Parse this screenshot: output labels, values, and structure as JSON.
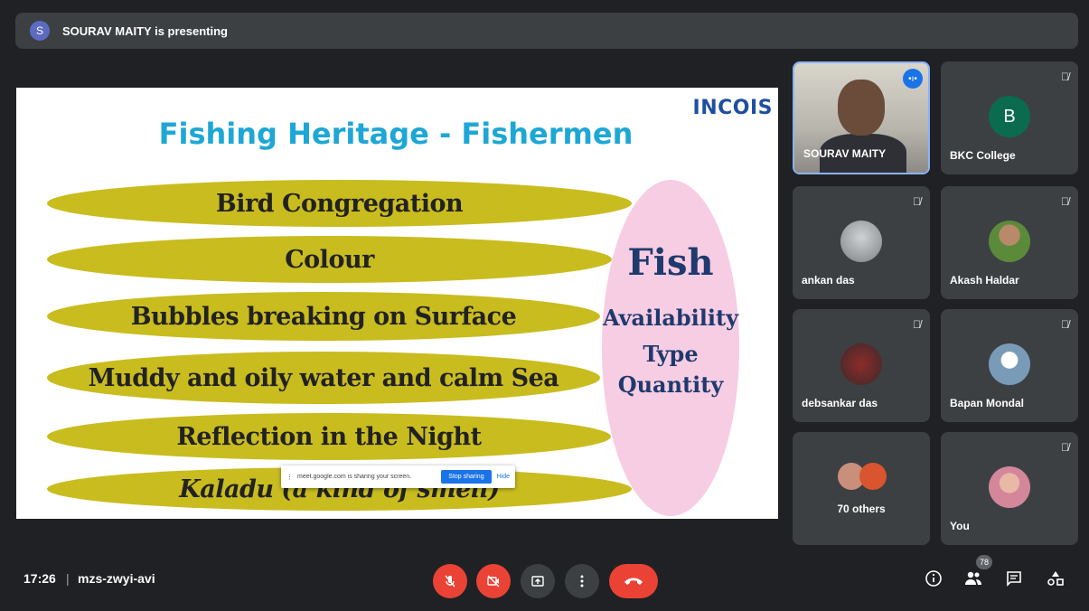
{
  "presenter_bar": {
    "avatar_letter": "S",
    "text": "SOURAV MAITY is presenting"
  },
  "slide": {
    "title": "Fishing Heritage - Fishermen",
    "logo_text": "INCOIS",
    "ellipses": [
      "Bird Congregation",
      "Colour",
      "Bubbles breaking on Surface",
      "Muddy and oily  water and calm Sea",
      "Reflection in the Night",
      "Kaladu (a kind of smell)"
    ],
    "pink": {
      "heading": "Fish",
      "lines": [
        "Availability",
        "Type",
        "Quantity"
      ]
    },
    "colors": {
      "title": "#1ea7d6",
      "ellipse": "#c9bc1f",
      "pink": "#f7cde3"
    }
  },
  "share_popup": {
    "text": "meet.google.com is sharing your screen.",
    "stop_label": "Stop sharing",
    "hide_label": "Hide"
  },
  "participants": [
    {
      "name": "SOURAV MAITY",
      "speaking": true
    },
    {
      "name": "BKC College",
      "avatar_letter": "B",
      "muted": true
    },
    {
      "name": "ankan das",
      "muted": true
    },
    {
      "name": "Akash Haldar",
      "muted": true
    },
    {
      "name": "debsankar das",
      "muted": true
    },
    {
      "name": "Bapan Mondal",
      "muted": true
    },
    {
      "name": "70 others"
    },
    {
      "name": "You",
      "muted": true
    }
  ],
  "bottom_bar": {
    "time": "17:26",
    "separator": "|",
    "meeting_code": "mzs-zwyi-avi",
    "participant_count": "78",
    "icons": [
      "mic-off-icon",
      "camera-off-icon",
      "present-icon",
      "more-icon",
      "end-call-icon",
      "info-icon",
      "people-icon",
      "chat-icon",
      "activities-icon"
    ]
  }
}
